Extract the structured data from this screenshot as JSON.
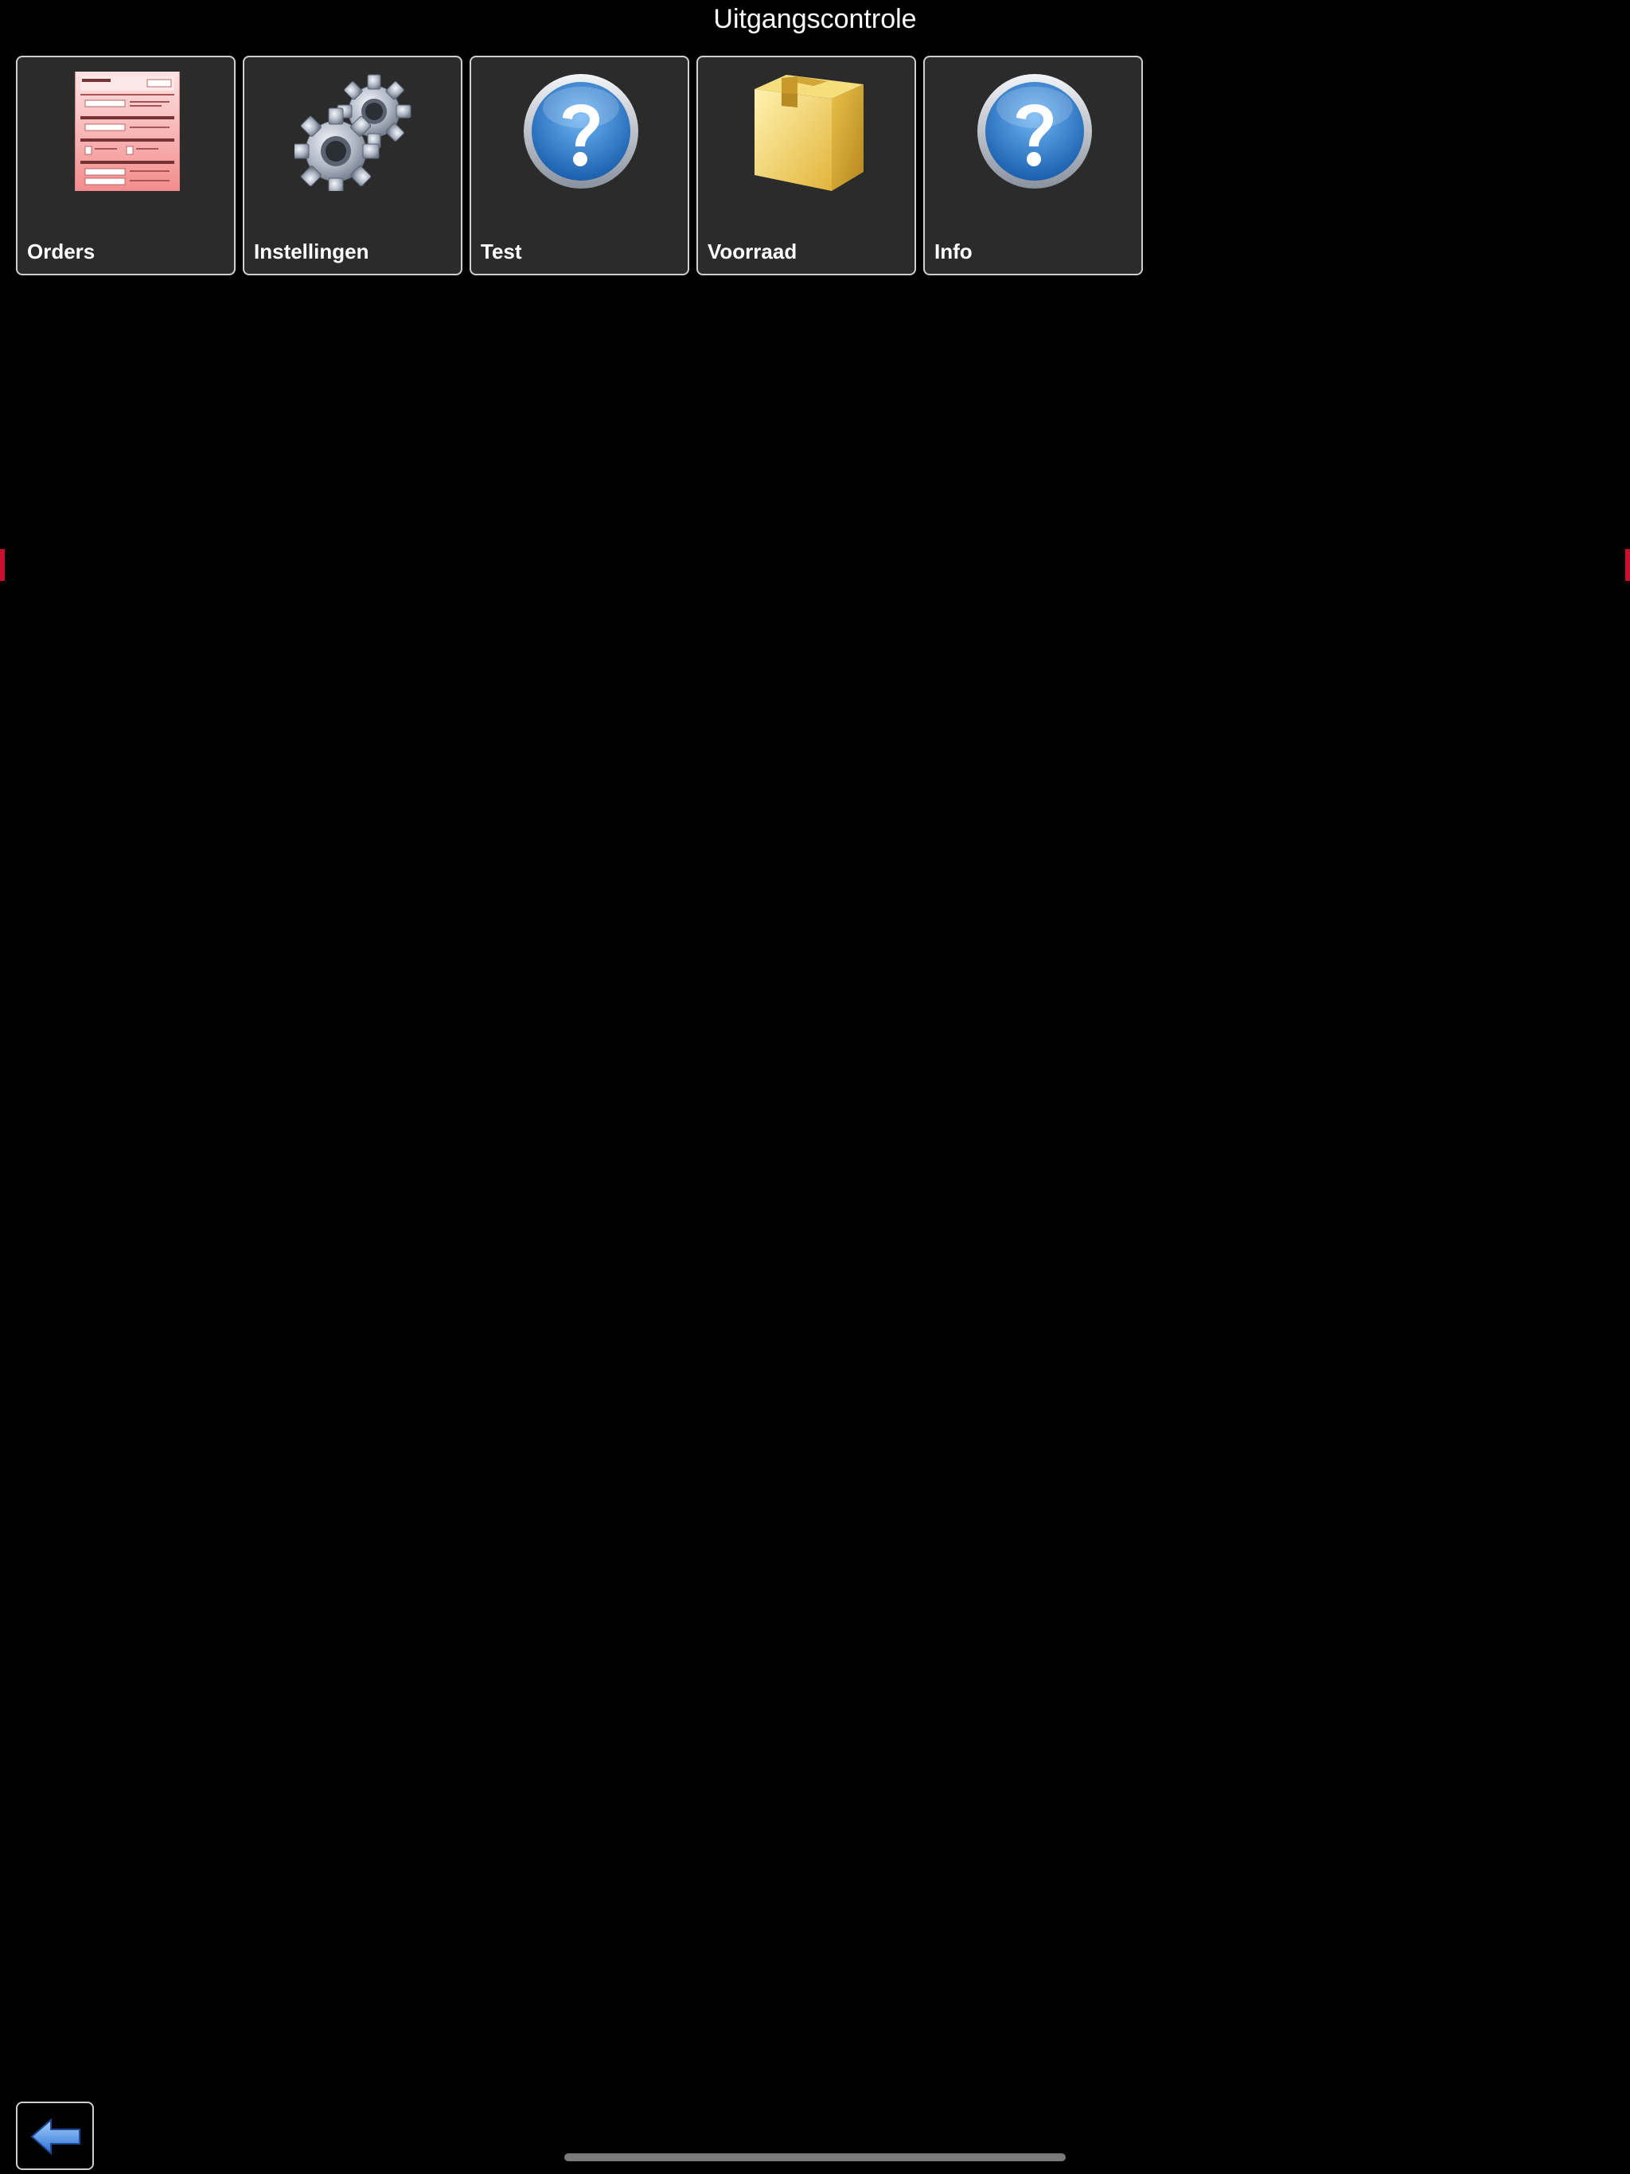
{
  "header": {
    "title": "Uitgangscontrole"
  },
  "tiles": [
    {
      "label": "Orders",
      "icon": "order-form-icon"
    },
    {
      "label": "Instellingen",
      "icon": "gears-icon"
    },
    {
      "label": "Test",
      "icon": "help-icon"
    },
    {
      "label": "Voorraad",
      "icon": "box-icon"
    },
    {
      "label": "Info",
      "icon": "help-icon"
    }
  ],
  "toolbar": {
    "back_icon": "back-arrow-icon"
  },
  "colors": {
    "background": "#000000",
    "tile_background": "#2b2b2b",
    "tile_border": "#cfcfcf",
    "help_blue": "#2a7fd4",
    "box_gold": "#e8c04a"
  }
}
